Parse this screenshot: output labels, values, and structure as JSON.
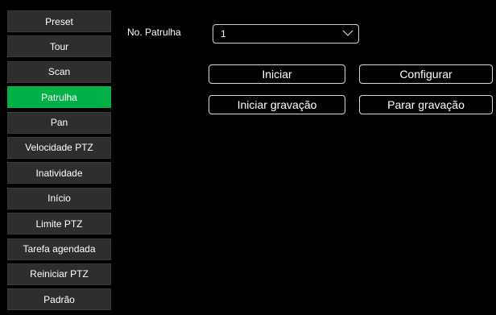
{
  "sidebar": {
    "items": [
      {
        "label": "Preset"
      },
      {
        "label": "Tour"
      },
      {
        "label": "Scan"
      },
      {
        "label": "Patrulha"
      },
      {
        "label": "Pan"
      },
      {
        "label": "Velocidade PTZ"
      },
      {
        "label": "Inatividade"
      },
      {
        "label": "Início"
      },
      {
        "label": "Limite PTZ"
      },
      {
        "label": "Tarefa agendada"
      },
      {
        "label": "Reiniciar PTZ"
      },
      {
        "label": "Padrão"
      }
    ],
    "active_index": 3
  },
  "patrol": {
    "label": "No. Patrulha",
    "selected_value": "1"
  },
  "buttons": {
    "start": "Iniciar",
    "configure": "Configurar",
    "start_recording": "Iniciar gravação",
    "stop_recording": "Parar gravação"
  },
  "colors": {
    "active": "#03b146",
    "sidebar_bg": "#2e2e2e",
    "background": "#000000"
  },
  "icons": {
    "select_chevron": "chevron-down-icon"
  }
}
